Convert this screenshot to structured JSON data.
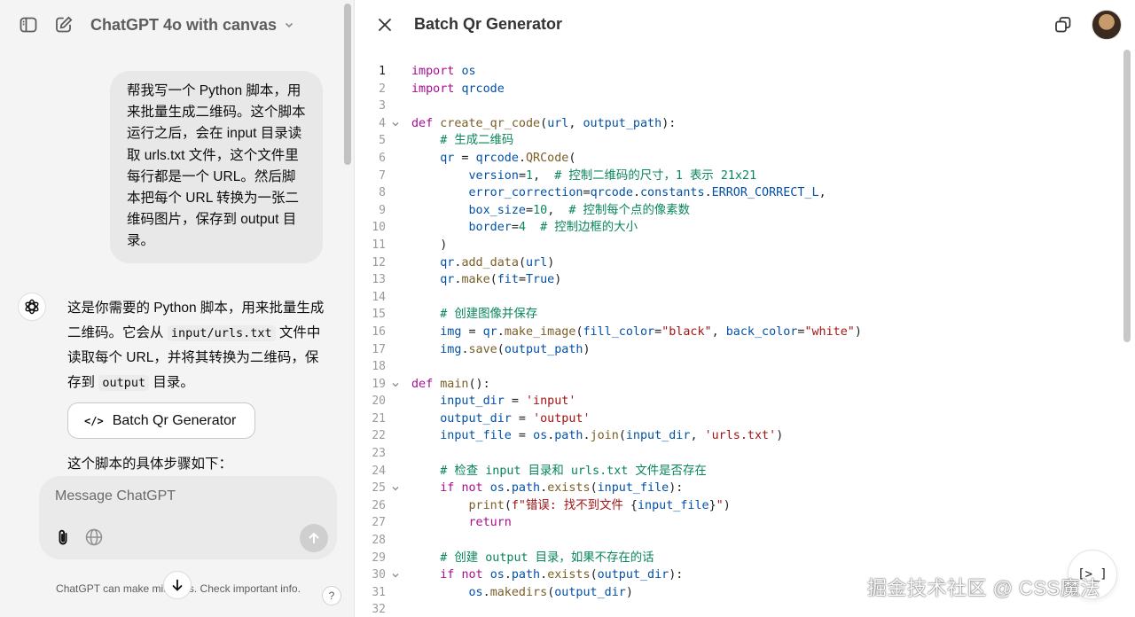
{
  "colors": {
    "chat_bg": "#f4f4f4",
    "bubble_bg": "#e8e8e8",
    "keyword": "#a90d91",
    "function": "#795e26",
    "variable": "#0451a5",
    "string": "#a31515",
    "comment": "#098658"
  },
  "chat": {
    "model_title": "ChatGPT 4o with canvas",
    "user_message": "帮我写一个 Python 脚本，用来批量生成二维码。这个脚本运行之后，会在 input 目录读取 urls.txt 文件，这个文件里每行都是一个 URL。然后脚本把每个 URL 转换为一张二维码图片，保存到 output 目录。",
    "assistant": {
      "part1": "这是你需要的 Python 脚本，用来批量生成二维码。它会从 ",
      "code1": "input/urls.txt",
      "part2": " 文件中读取每个 URL，并将其转换为二维码，保存到 ",
      "code2": "output",
      "part3": " 目录。"
    },
    "canvas_chip_label": "Batch Qr Generator",
    "steps_intro": "这个脚本的具体步骤如下：",
    "composer_placeholder": "Message ChatGPT",
    "disclaimer": "ChatGPT can make mistakes. Check important info.",
    "help_label": "?"
  },
  "canvas": {
    "title": "Batch Qr Generator",
    "fab_label": "[>_]",
    "watermark": "掘金技术社区 @ CSS魔法",
    "lines": [
      {
        "n": "1",
        "active": true,
        "fold": false,
        "html": "<span class=\"kw\">import</span> <span class=\"var\">os</span>"
      },
      {
        "n": "2",
        "fold": false,
        "html": "<span class=\"kw\">import</span> <span class=\"var\">qrcode</span>"
      },
      {
        "n": "3",
        "fold": false,
        "html": ""
      },
      {
        "n": "4",
        "fold": true,
        "html": "<span class=\"kw\">def</span> <span class=\"fn\">create_qr_code</span>(<span class=\"var\">url</span>, <span class=\"var\">output_path</span>):"
      },
      {
        "n": "5",
        "fold": false,
        "html": "    <span class=\"cmt\"># 生成二维码</span>"
      },
      {
        "n": "6",
        "fold": false,
        "html": "    <span class=\"var\">qr</span> = <span class=\"var\">qrcode</span>.<span class=\"fn\">QRCode</span>("
      },
      {
        "n": "7",
        "fold": false,
        "html": "        <span class=\"var\">version</span>=<span class=\"num\">1</span>,  <span class=\"cmt\"># 控制二维码的尺寸，1 表示 21x21</span>"
      },
      {
        "n": "8",
        "fold": false,
        "html": "        <span class=\"var\">error_correction</span>=<span class=\"var\">qrcode</span>.<span class=\"var\">constants</span>.<span class=\"var\">ERROR_CORRECT_L</span>,"
      },
      {
        "n": "9",
        "fold": false,
        "html": "        <span class=\"var\">box_size</span>=<span class=\"num\">10</span>,  <span class=\"cmt\"># 控制每个点的像素数</span>"
      },
      {
        "n": "10",
        "fold": false,
        "html": "        <span class=\"var\">border</span>=<span class=\"num\">4</span>  <span class=\"cmt\"># 控制边框的大小</span>"
      },
      {
        "n": "11",
        "fold": false,
        "html": "    )"
      },
      {
        "n": "12",
        "fold": false,
        "html": "    <span class=\"var\">qr</span>.<span class=\"fn\">add_data</span>(<span class=\"var\">url</span>)"
      },
      {
        "n": "13",
        "fold": false,
        "html": "    <span class=\"var\">qr</span>.<span class=\"fn\">make</span>(<span class=\"var\">fit</span>=<span class=\"var\">True</span>)"
      },
      {
        "n": "14",
        "fold": false,
        "html": ""
      },
      {
        "n": "15",
        "fold": false,
        "html": "    <span class=\"cmt\"># 创建图像并保存</span>"
      },
      {
        "n": "16",
        "fold": false,
        "html": "    <span class=\"var\">img</span> = <span class=\"var\">qr</span>.<span class=\"fn\">make_image</span>(<span class=\"var\">fill_color</span>=<span class=\"str\">\"black\"</span>, <span class=\"var\">back_color</span>=<span class=\"str\">\"white\"</span>)"
      },
      {
        "n": "17",
        "fold": false,
        "html": "    <span class=\"var\">img</span>.<span class=\"fn\">save</span>(<span class=\"var\">output_path</span>)"
      },
      {
        "n": "18",
        "fold": false,
        "html": ""
      },
      {
        "n": "19",
        "fold": true,
        "html": "<span class=\"kw\">def</span> <span class=\"fn\">main</span>():"
      },
      {
        "n": "20",
        "fold": false,
        "html": "    <span class=\"var\">input_dir</span> = <span class=\"str\">'input'</span>"
      },
      {
        "n": "21",
        "fold": false,
        "html": "    <span class=\"var\">output_dir</span> = <span class=\"str\">'output'</span>"
      },
      {
        "n": "22",
        "fold": false,
        "html": "    <span class=\"var\">input_file</span> = <span class=\"var\">os</span>.<span class=\"var\">path</span>.<span class=\"fn\">join</span>(<span class=\"var\">input_dir</span>, <span class=\"str\">'urls.txt'</span>)"
      },
      {
        "n": "23",
        "fold": false,
        "html": ""
      },
      {
        "n": "24",
        "fold": false,
        "html": "    <span class=\"cmt\"># 检查 input 目录和 urls.txt 文件是否存在</span>"
      },
      {
        "n": "25",
        "fold": true,
        "html": "    <span class=\"kw\">if</span> <span class=\"kw\">not</span> <span class=\"var\">os</span>.<span class=\"var\">path</span>.<span class=\"fn\">exists</span>(<span class=\"var\">input_file</span>):"
      },
      {
        "n": "26",
        "fold": false,
        "html": "        <span class=\"fn\">print</span>(<span class=\"str\">f\"错误: 找不到文件 </span>{<span class=\"var\">input_file</span>}<span class=\"str\">\"</span>)"
      },
      {
        "n": "27",
        "fold": false,
        "html": "        <span class=\"kw\">return</span>"
      },
      {
        "n": "28",
        "fold": false,
        "html": ""
      },
      {
        "n": "29",
        "fold": false,
        "html": "    <span class=\"cmt\"># 创建 output 目录，如果不存在的话</span>"
      },
      {
        "n": "30",
        "fold": true,
        "html": "    <span class=\"kw\">if</span> <span class=\"kw\">not</span> <span class=\"var\">os</span>.<span class=\"var\">path</span>.<span class=\"fn\">exists</span>(<span class=\"var\">output_dir</span>):"
      },
      {
        "n": "31",
        "fold": false,
        "html": "        <span class=\"var\">os</span>.<span class=\"fn\">makedirs</span>(<span class=\"var\">output_dir</span>)"
      },
      {
        "n": "32",
        "fold": false,
        "html": ""
      }
    ]
  }
}
